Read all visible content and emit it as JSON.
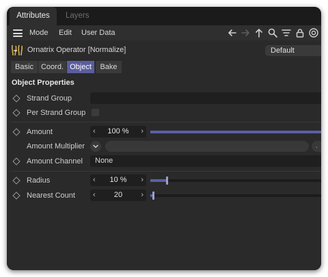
{
  "tabs": [
    {
      "label": "Attributes",
      "active": true
    },
    {
      "label": "Layers",
      "active": false
    }
  ],
  "menu": {
    "items": [
      "Mode",
      "Edit",
      "User Data"
    ]
  },
  "toolbar_icons": [
    "arrow-left-icon",
    "arrow-right-icon",
    "arrow-up-icon",
    "search-icon",
    "filter-icon",
    "lock-icon",
    "target-icon"
  ],
  "object": {
    "title": "Ornatrix Operator [Normalize]",
    "layer_dropdown": "Default"
  },
  "subtabs": [
    {
      "label": "Basic",
      "active": false
    },
    {
      "label": "Coord.",
      "active": false
    },
    {
      "label": "Object",
      "active": true
    },
    {
      "label": "Bake",
      "active": false
    }
  ],
  "section": {
    "title": "Object Properties"
  },
  "properties": {
    "strand_group": {
      "label": "Strand Group",
      "value": ""
    },
    "per_strand_group": {
      "label": "Per Strand Group",
      "checked": false
    },
    "amount": {
      "label": "Amount",
      "value": "100 %",
      "fraction": 1.0
    },
    "amount_multiplier": {
      "label": "Amount Multiplier"
    },
    "amount_channel": {
      "label": "Amount Channel",
      "value": "None"
    },
    "radius": {
      "label": "Radius",
      "value": "10 %",
      "fraction": 0.1
    },
    "nearest_count": {
      "label": "Nearest Count",
      "value": "20",
      "fraction": 0.02
    }
  },
  "colors": {
    "accent": "#5a5e9e",
    "panel": "#2a2a2a",
    "field": "#1f1f1f"
  }
}
